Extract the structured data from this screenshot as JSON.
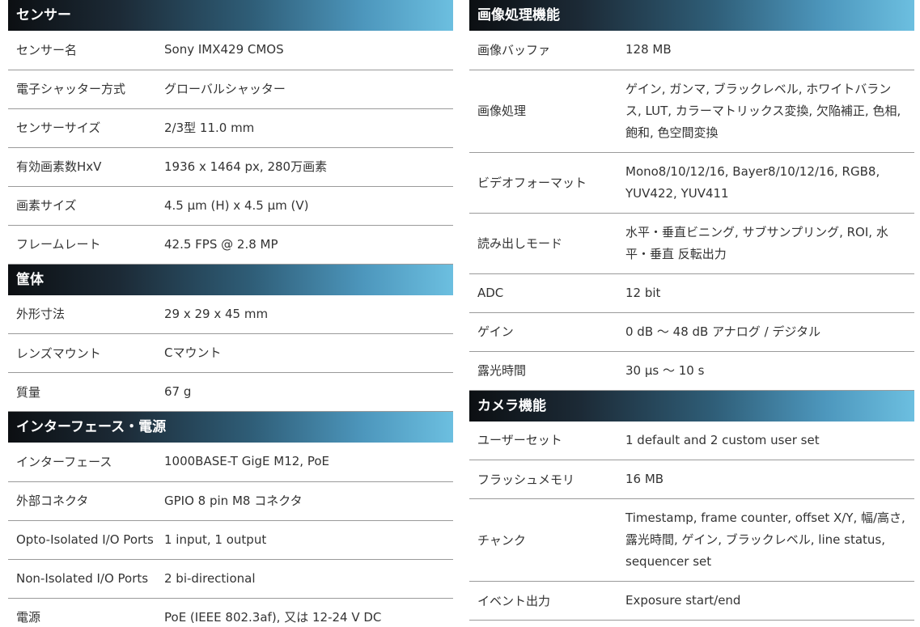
{
  "left_sections": [
    {
      "title": "センサー",
      "rows": [
        {
          "label": "センサー名",
          "value": "Sony IMX429 CMOS"
        },
        {
          "label": "電子シャッター方式",
          "value": "グローバルシャッター"
        },
        {
          "label": "センサーサイズ",
          "value": "2/3型 11.0 mm"
        },
        {
          "label": "有効画素数HxV",
          "value": "1936 x 1464 px, 280万画素"
        },
        {
          "label": "画素サイズ",
          "value": "4.5 µm (H) x 4.5 µm (V)"
        },
        {
          "label": "フレームレート",
          "value": "42.5 FPS @ 2.8 MP"
        }
      ]
    },
    {
      "title": "筐体",
      "rows": [
        {
          "label": "外形寸法",
          "value": "29 x 29 x 45 mm"
        },
        {
          "label": "レンズマウント",
          "value": "Cマウント"
        },
        {
          "label": "質量",
          "value": "67 g"
        }
      ]
    },
    {
      "title": "インターフェース・電源",
      "rows": [
        {
          "label": "インターフェース",
          "value": "1000BASE-T GigE M12, PoE"
        },
        {
          "label": "外部コネクタ",
          "value": "GPIO 8 pin M8 コネクタ"
        },
        {
          "label": "Opto-Isolated I/O Ports",
          "value": "1 input, 1 output"
        },
        {
          "label": "Non-Isolated I/O Ports",
          "value": "2 bi-directional"
        },
        {
          "label": "電源",
          "value": "PoE (IEEE 802.3af), 又は 12-24 V DC"
        }
      ]
    }
  ],
  "right_sections": [
    {
      "title": "画像処理機能",
      "rows": [
        {
          "label": "画像バッファ",
          "value": "128 MB"
        },
        {
          "label": "画像処理",
          "value": "ゲイン, ガンマ, ブラックレベル, ホワイトバランス, LUT, カラーマトリックス変換, 欠陥補正, 色相, 飽和, 色空間変換"
        },
        {
          "label": "ビデオフォーマット",
          "value": "Mono8/10/12/16, Bayer8/10/12/16, RGB8, YUV422, YUV411"
        },
        {
          "label": "読み出しモード",
          "value": "水平・垂直ビニング, サブサンプリング, ROI, 水平・垂直 反転出力"
        },
        {
          "label": "ADC",
          "value": "12 bit"
        },
        {
          "label": "ゲイン",
          "value": "0 dB ～ 48 dB アナログ / デジタル"
        },
        {
          "label": "露光時間",
          "value": "30 µs ～ 10 s"
        }
      ]
    },
    {
      "title": "カメラ機能",
      "rows": [
        {
          "label": "ユーザーセット",
          "value": "1 default and 2 custom user set"
        },
        {
          "label": "フラッシュメモリ",
          "value": "16 MB"
        },
        {
          "label": "チャンク",
          "value": "Timestamp, frame counter, offset X/Y, 幅/高さ, 露光時間, ゲイン, ブラックレベル, line status, sequencer set"
        },
        {
          "label": "イベント出力",
          "value": "Exposure start/end"
        }
      ]
    }
  ]
}
